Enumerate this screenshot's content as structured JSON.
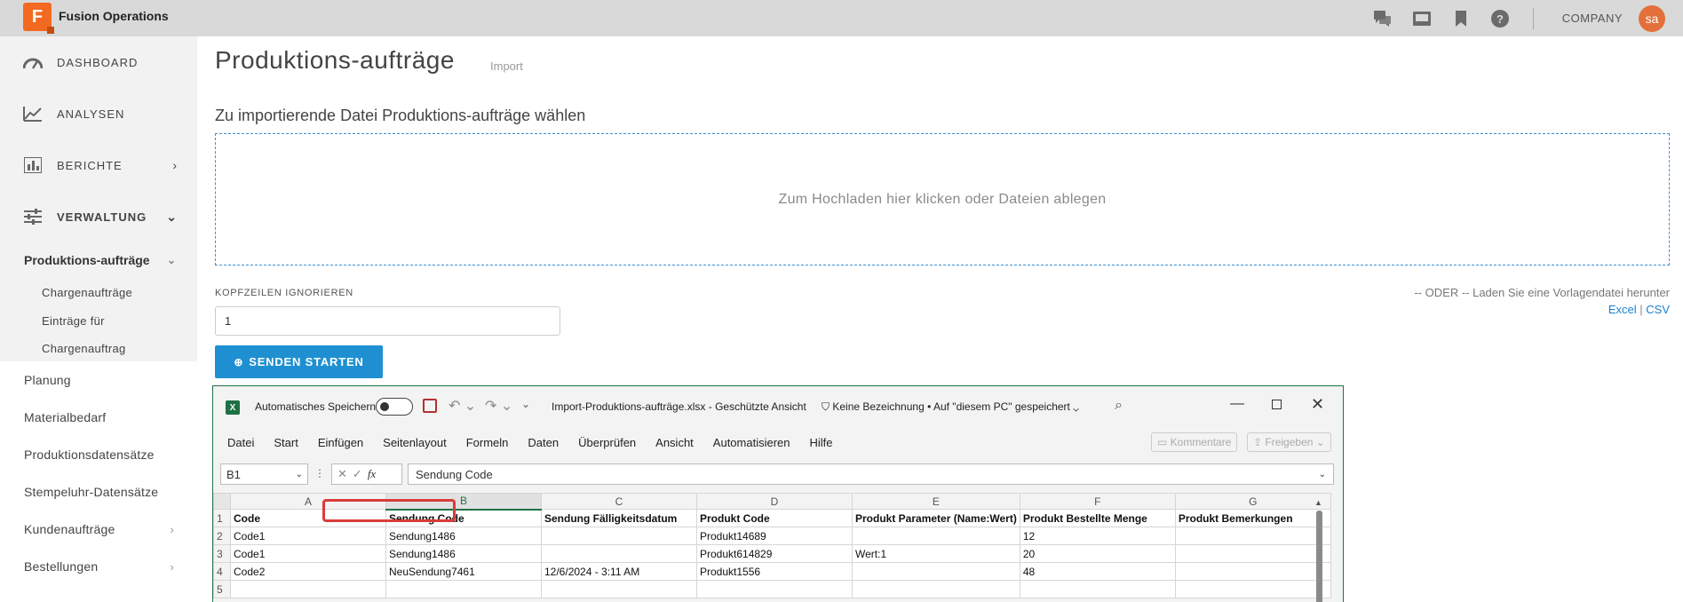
{
  "app": {
    "logo_letter": "F",
    "title": "Fusion Operations",
    "company": "COMPANY",
    "avatar": "sa"
  },
  "topbar_icons": [
    "chat-icon",
    "monitor-icon",
    "bookmark-icon",
    "help-icon"
  ],
  "sidebar": {
    "main": [
      {
        "label": "DASHBOARD",
        "icon": "speedometer-icon"
      },
      {
        "label": "ANALYSEN",
        "icon": "line-chart-icon"
      },
      {
        "label": "BERICHTE",
        "icon": "bar-chart-icon",
        "chevron": "›"
      },
      {
        "label": "VERWALTUNG",
        "icon": "sliders-icon",
        "chevron": "⌄"
      }
    ],
    "active_group": "Produktions-aufträge",
    "sub_items": [
      "Chargenaufträge",
      "Einträge für",
      "Chargenauftrag"
    ],
    "more": [
      {
        "label": "Planung"
      },
      {
        "label": "Materialbedarf"
      },
      {
        "label": "Produktionsdatensätze"
      },
      {
        "label": "Stempeluhr-Datensätze"
      },
      {
        "label": "Kundenaufträge",
        "chevron": "›"
      },
      {
        "label": "Bestellungen",
        "chevron": "›"
      }
    ]
  },
  "main": {
    "title": "Produktions-aufträge",
    "subtitle": "Import",
    "section_title": "Zu importierende Datei Produktions-aufträge wählen",
    "dropzone_text": "Zum Hochladen hier klicken oder Dateien ablegen",
    "header_label": "KOPFZEILEN IGNORIEREN",
    "header_value": "1",
    "start_button": "SENDEN STARTEN",
    "or_text": "-- ODER -- Laden Sie eine Vorlagendatei herunter",
    "link_excel": "Excel",
    "link_sep": "|",
    "link_csv": "CSV"
  },
  "excel": {
    "autosave_label": "Automatisches Speichern",
    "filename": "Import-Produktions-aufträge.xlsx  -  Geschützte Ansicht",
    "label_info": "Keine Bezeichnung  •  Auf \"diesem PC\" gespeichert",
    "menu": [
      "Datei",
      "Start",
      "Einfügen",
      "Seitenlayout",
      "Formeln",
      "Daten",
      "Überprüfen",
      "Ansicht",
      "Automatisieren",
      "Hilfe"
    ],
    "comments_button": "Kommentare",
    "share_button": "Freigeben",
    "name_box": "B1",
    "fx_symbol": "fx",
    "formula_value": "Sendung Code",
    "columns": [
      "A",
      "B",
      "C",
      "D",
      "E",
      "F",
      "G"
    ],
    "rows": [
      {
        "n": "1",
        "cells": [
          "Code",
          "Sendung Code",
          "Sendung Fälligkeitsdatum",
          "Produkt Code",
          "Produkt Parameter (Name:Wert)",
          "Produkt Bestellte Menge",
          "Produkt Bemerkungen"
        ]
      },
      {
        "n": "2",
        "cells": [
          "Code1",
          "Sendung1486",
          "",
          "Produkt14689",
          "",
          "12",
          ""
        ]
      },
      {
        "n": "3",
        "cells": [
          "Code1",
          "Sendung1486",
          "",
          "Produkt614829",
          "Wert:1",
          "20",
          ""
        ]
      },
      {
        "n": "4",
        "cells": [
          "Code2",
          "NeuSendung7461",
          "12/6/2024 - 3:11 AM",
          "Produkt1556",
          "",
          "48",
          ""
        ]
      },
      {
        "n": "5",
        "cells": [
          "",
          "",
          "",
          "",
          "",
          "",
          ""
        ]
      }
    ]
  }
}
